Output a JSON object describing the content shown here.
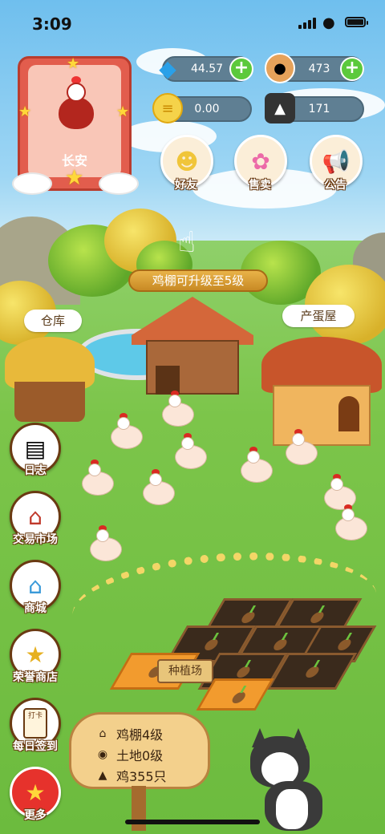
{
  "status_bar": {
    "time": "3:09"
  },
  "profile": {
    "name": "长安"
  },
  "resources": {
    "diamond": "44.57",
    "eggs": "473",
    "coins": "0.00",
    "badge": "171"
  },
  "top_buttons": [
    {
      "label": "好友",
      "icon": "friend-icon"
    },
    {
      "label": "售卖",
      "icon": "lollipop-icon"
    },
    {
      "label": "公告",
      "icon": "megaphone-icon"
    }
  ],
  "farm": {
    "upgrade_banner": "鸡棚可升级至5级",
    "warehouse_tag": "仓库",
    "egg_house_tag": "产蛋屋",
    "field_sign": "种植场"
  },
  "side_menu": [
    {
      "label": "日志",
      "icon": "log-icon"
    },
    {
      "label": "交易市场",
      "icon": "market-icon"
    },
    {
      "label": "商城",
      "icon": "shop-icon"
    },
    {
      "label": "荣誉商店",
      "icon": "honor-store-icon"
    },
    {
      "label": "每日签到",
      "icon": "checkin-icon"
    },
    {
      "label": "更多",
      "icon": "star-icon"
    }
  ],
  "info_board": {
    "coop_level": "鸡棚4级",
    "land_level": "土地0级",
    "chicken_count": "鸡355只"
  },
  "checkin_card_text": "打卡",
  "colors": {
    "sky": "#7cc6f0",
    "grass": "#7cc54a",
    "accent_green": "#5cc93c",
    "avatar_red": "#e25d4d"
  }
}
